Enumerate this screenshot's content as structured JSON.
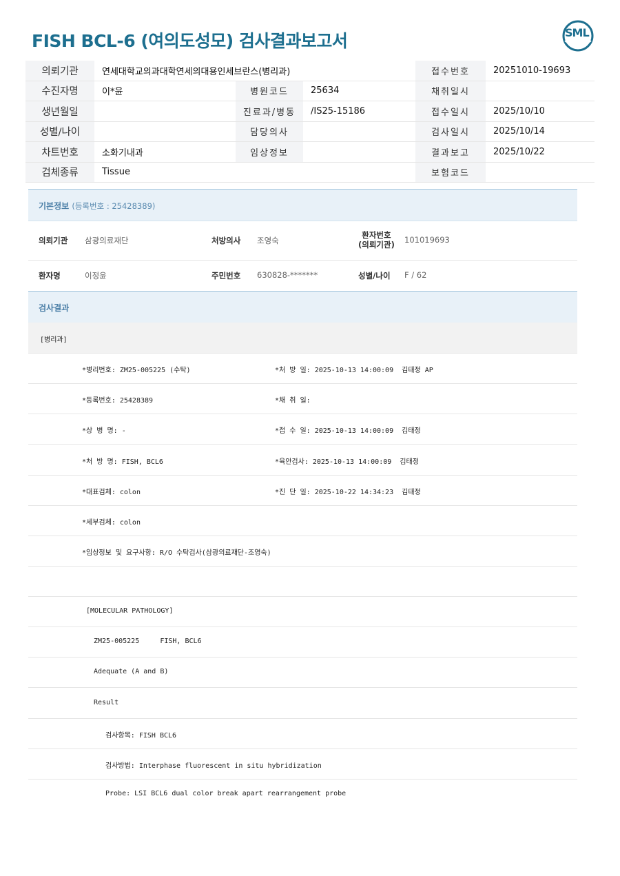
{
  "report": {
    "title": "FISH BCL-6 (여의도성모) 검사결과보고서",
    "logo": "SML"
  },
  "header": {
    "rows": [
      {
        "l1": "의뢰기관",
        "v1": "연세대학교의과대학연세의대용인세브란스(병리과)",
        "l2": "",
        "v2": "",
        "l3": "접수번호",
        "v3": "20251010-19693"
      },
      {
        "l1": "수진자명",
        "v1": "이*윤",
        "l2": "병원코드",
        "v2": "25634",
        "l3": "채취일시",
        "v3": ""
      },
      {
        "l1": "생년월일",
        "v1": "",
        "l2": "진료과/병동",
        "v2": "/IS25-15186",
        "l3": "접수일시",
        "v3": "2025/10/10"
      },
      {
        "l1": "성별/나이",
        "v1": "",
        "l2": "담당의사",
        "v2": "",
        "l3": "검사일시",
        "v3": "2025/10/14"
      },
      {
        "l1": "차트번호",
        "v1": "소화기내과",
        "l2": "임상정보",
        "v2": "",
        "l3": "결과보고",
        "v3": "2025/10/22"
      },
      {
        "l1": "검체종류",
        "v1": "Tissue",
        "l2": "",
        "v2": "",
        "l3": "보험코드",
        "v3": ""
      }
    ]
  },
  "basic_info": {
    "title": "기본정보",
    "subtitle": "(등록번호 : 25428389)",
    "req_org_label": "의뢰기관",
    "req_org": "삼광의료재단",
    "doctor_label": "처방의사",
    "doctor": "조영숙",
    "patient_no_label_1": "환자번호",
    "patient_no_label_2": "(의뢰기관)",
    "patient_no": "101019693",
    "patient_name_label": "환자명",
    "patient_name": "이정윤",
    "rrn_label": "주민번호",
    "rrn": "630828-*******",
    "sex_age_label": "성별/나이",
    "sex_age": "F / 62"
  },
  "results": {
    "title": "검사결과",
    "dept": "[병리과]",
    "pairs": [
      {
        "left": "*병리번호: ZM25-005225 (수탁)",
        "right": "*처 방 일: 2025-10-13 14:00:09  김태정 AP"
      },
      {
        "left": "*등록번호: 25428389",
        "right": "*채 취 일:"
      },
      {
        "left": "*상 병 명: -",
        "right": "*접 수 일: 2025-10-13 14:00:09  김태정"
      },
      {
        "left": "*처 방 명: FISH, BCL6",
        "right": "*육안검사: 2025-10-13 14:00:09  김태정"
      },
      {
        "left": "*대표검체: colon",
        "right": "*진 단 일: 2025-10-22 14:34:23  김태정"
      },
      {
        "left": "*세부검체: colon",
        "right": ""
      },
      {
        "left": "*임상정보 및 요구사항: R/O 수탁검사(삼광의료재단-조영숙)",
        "right": ""
      }
    ],
    "body": [
      {
        "text": "[MOLECULAR PATHOLOGY]",
        "indent": 1
      },
      {
        "text": "ZM25-005225     FISH, BCL6",
        "indent": 2
      },
      {
        "text": "Adequate (A and B)",
        "indent": 2
      },
      {
        "text": "Result",
        "indent": 2
      },
      {
        "text": "검사항목: FISH BCL6",
        "indent": 3
      },
      {
        "text": "검사방법: Interphase fluorescent in situ hybridization",
        "indent": 3
      },
      {
        "text": "Probe: LSI BCL6 dual color break apart rearrangement probe",
        "indent": 3
      }
    ]
  }
}
